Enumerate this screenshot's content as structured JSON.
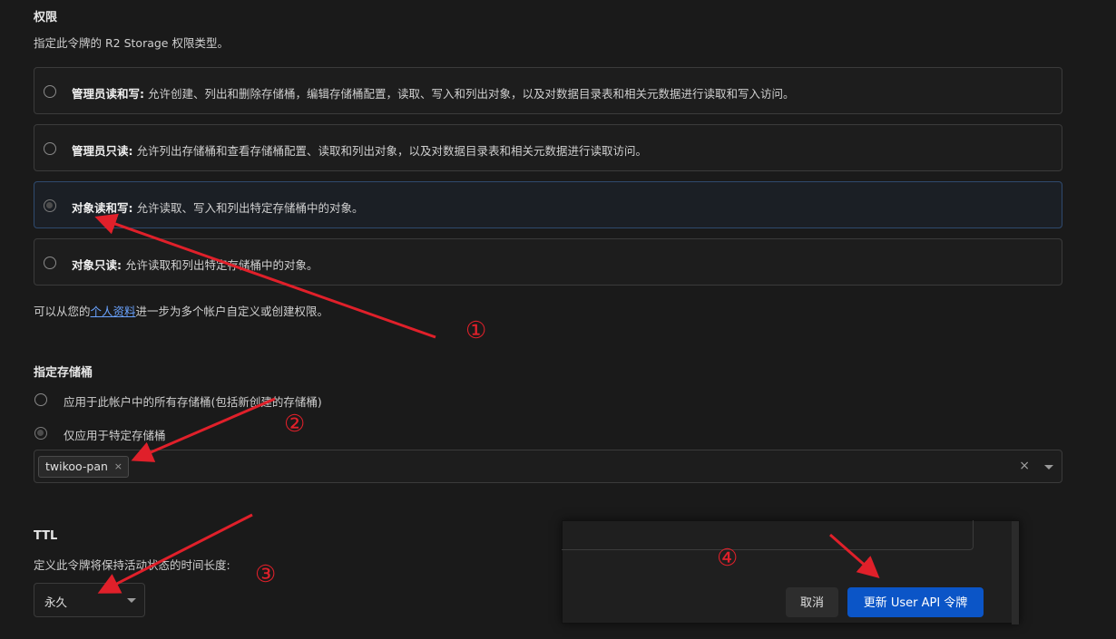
{
  "permissions": {
    "title": "权限",
    "description": "指定此令牌的 R2 Storage 权限类型。",
    "options": [
      {
        "name": "管理员读和写:",
        "desc": "允许创建、列出和删除存储桶，编辑存储桶配置，读取、写入和列出对象，以及对数据目录表和相关元数据进行读取和写入访问。"
      },
      {
        "name": "管理员只读:",
        "desc": "允许列出存储桶和查看存储桶配置、读取和列出对象，以及对数据目录表和相关元数据进行读取访问。"
      },
      {
        "name": "对象读和写:",
        "desc": "允许读取、写入和列出特定存储桶中的对象。"
      },
      {
        "name": "对象只读:",
        "desc": "允许读取和列出特定存储桶中的对象。"
      }
    ],
    "selected_index": 2,
    "profile_note_prefix": "可以从您的",
    "profile_link": "个人资料",
    "profile_note_suffix": "进一步为多个帐户自定义或创建权限。"
  },
  "buckets": {
    "title": "指定存储桶",
    "options": [
      "应用于此帐户中的所有存储桶(包括新创建的存储桶)",
      "仅应用于特定存储桶"
    ],
    "selected_index": 1,
    "selected_bucket": "twikoo-pan",
    "chip_remove": "×",
    "clear": "×"
  },
  "ttl": {
    "title": "TTL",
    "description": "定义此令牌将保持活动状态的时间长度:",
    "value": "永久"
  },
  "dialog": {
    "cancel_label": "取消",
    "submit_label": "更新 User API 令牌"
  },
  "annotations": {
    "one": "①",
    "two": "②",
    "three": "③",
    "four": "④",
    "color": "#e0202a"
  }
}
